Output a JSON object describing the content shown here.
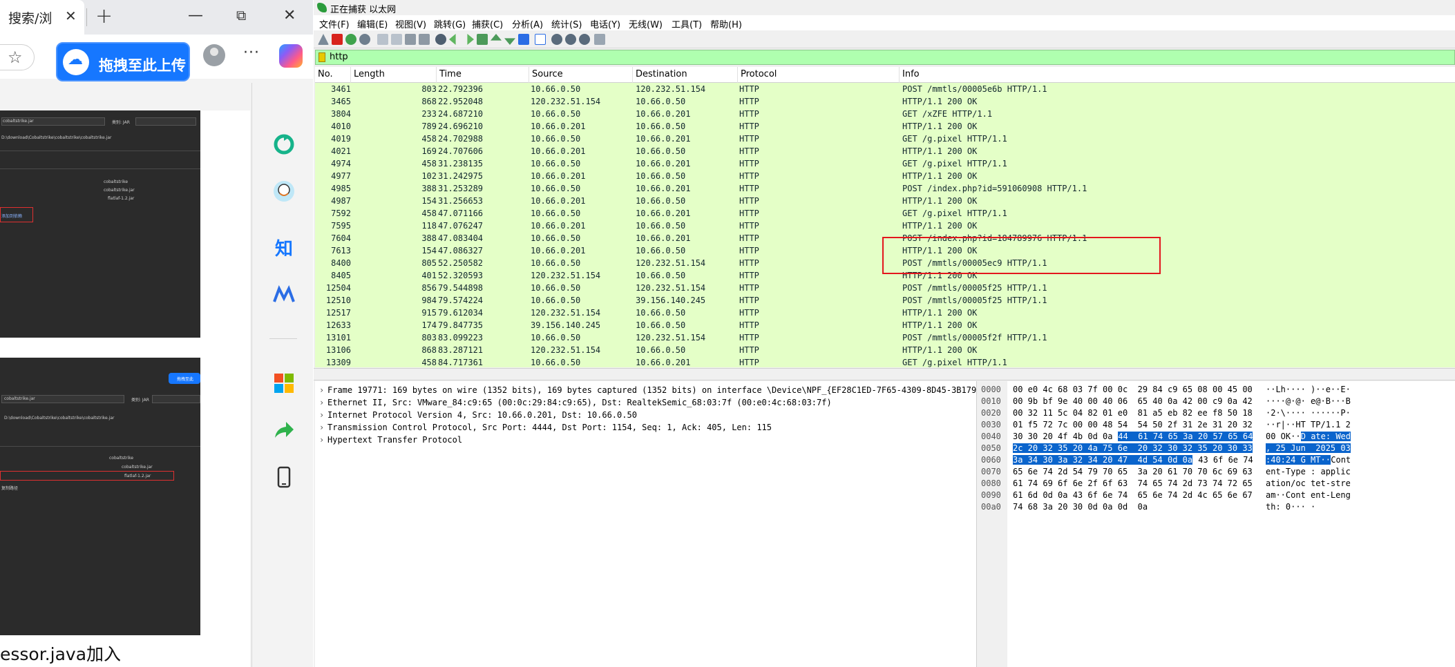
{
  "browser": {
    "tab_title": "搜索/浏",
    "tab_close": "✕",
    "new_tab": "+",
    "win_min": "—",
    "win_max": "⧉",
    "win_close": "✕",
    "upload_label": "拖拽至此上传",
    "more": "···",
    "caption": "essor.java加入",
    "shot1": {
      "label_a": "cobaltstrike.jar",
      "label_b": "类别: JAR",
      "path": "D:\\download\\Cobaltstrike\\cobaltstrike\\cobaltstrike.jar",
      "tree_a": "cobaltstrike",
      "tree_b": "cobaltstrike.jar",
      "tree_c": "flatlaf-1.2.jar",
      "highlight": "添加到依赖"
    },
    "shot2": {
      "upload_badge": "拖拽至此",
      "label_a": "cobaltstrike.jar",
      "label_b": "类别: JAR",
      "path": "D:\\download\\Cobaltstrike\\cobaltstrike\\cobaltstrike.jar",
      "tree_a": "cobaltstrike",
      "tree_b": "cobaltstrike.jar",
      "tree_c": "flatlaf-1.2.jar",
      "extra": "复制路径"
    }
  },
  "wireshark": {
    "title": "正在捕获 以太网",
    "menu": [
      "文件(F)",
      "编辑(E)",
      "视图(V)",
      "跳转(G)",
      "捕获(C)",
      "分析(A)",
      "统计(S)",
      "电话(Y)",
      "无线(W)",
      "工具(T)",
      "帮助(H)"
    ],
    "filter": "http",
    "columns": [
      "No.",
      "Length",
      "Time",
      "Source",
      "Destination",
      "Protocol",
      "Info"
    ],
    "packets": [
      {
        "no": "3461",
        "len": "803",
        "time": "22.792396",
        "src": "10.66.0.50",
        "dst": "120.232.51.154",
        "proto": "HTTP",
        "info": "POST /mmtls/00005e6b HTTP/1.1"
      },
      {
        "no": "3465",
        "len": "868",
        "time": "22.952048",
        "src": "120.232.51.154",
        "dst": "10.66.0.50",
        "proto": "HTTP",
        "info": "HTTP/1.1 200 OK"
      },
      {
        "no": "3804",
        "len": "233",
        "time": "24.687210",
        "src": "10.66.0.50",
        "dst": "10.66.0.201",
        "proto": "HTTP",
        "info": "GET /xZFE HTTP/1.1"
      },
      {
        "no": "4010",
        "len": "789",
        "time": "24.696210",
        "src": "10.66.0.201",
        "dst": "10.66.0.50",
        "proto": "HTTP",
        "info": "HTTP/1.1 200 OK"
      },
      {
        "no": "4019",
        "len": "458",
        "time": "24.702988",
        "src": "10.66.0.50",
        "dst": "10.66.0.201",
        "proto": "HTTP",
        "info": "GET /g.pixel HTTP/1.1"
      },
      {
        "no": "4021",
        "len": "169",
        "time": "24.707606",
        "src": "10.66.0.201",
        "dst": "10.66.0.50",
        "proto": "HTTP",
        "info": "HTTP/1.1 200 OK"
      },
      {
        "no": "4974",
        "len": "458",
        "time": "31.238135",
        "src": "10.66.0.50",
        "dst": "10.66.0.201",
        "proto": "HTTP",
        "info": "GET /g.pixel HTTP/1.1"
      },
      {
        "no": "4977",
        "len": "102",
        "time": "31.242975",
        "src": "10.66.0.201",
        "dst": "10.66.0.50",
        "proto": "HTTP",
        "info": "HTTP/1.1 200 OK"
      },
      {
        "no": "4985",
        "len": "388",
        "time": "31.253289",
        "src": "10.66.0.50",
        "dst": "10.66.0.201",
        "proto": "HTTP",
        "info": "POST /index.php?id=591060908 HTTP/1.1"
      },
      {
        "no": "4987",
        "len": "154",
        "time": "31.256653",
        "src": "10.66.0.201",
        "dst": "10.66.0.50",
        "proto": "HTTP",
        "info": "HTTP/1.1 200 OK"
      },
      {
        "no": "7592",
        "len": "458",
        "time": "47.071166",
        "src": "10.66.0.50",
        "dst": "10.66.0.201",
        "proto": "HTTP",
        "info": "GET /g.pixel HTTP/1.1"
      },
      {
        "no": "7595",
        "len": "118",
        "time": "47.076247",
        "src": "10.66.0.201",
        "dst": "10.66.0.50",
        "proto": "HTTP",
        "info": "HTTP/1.1 200 OK"
      },
      {
        "no": "7604",
        "len": "388",
        "time": "47.083404",
        "src": "10.66.0.50",
        "dst": "10.66.0.201",
        "proto": "HTTP",
        "info": "POST /index.php?id=184789976 HTTP/1.1"
      },
      {
        "no": "7613",
        "len": "154",
        "time": "47.086327",
        "src": "10.66.0.201",
        "dst": "10.66.0.50",
        "proto": "HTTP",
        "info": "HTTP/1.1 200 OK"
      },
      {
        "no": "8400",
        "len": "805",
        "time": "52.250582",
        "src": "10.66.0.50",
        "dst": "120.232.51.154",
        "proto": "HTTP",
        "info": "POST /mmtls/00005ec9 HTTP/1.1"
      },
      {
        "no": "8405",
        "len": "401",
        "time": "52.320593",
        "src": "120.232.51.154",
        "dst": "10.66.0.50",
        "proto": "HTTP",
        "info": "HTTP/1.1 200 OK"
      },
      {
        "no": "12504",
        "len": "856",
        "time": "79.544898",
        "src": "10.66.0.50",
        "dst": "120.232.51.154",
        "proto": "HTTP",
        "info": "POST /mmtls/00005f25 HTTP/1.1"
      },
      {
        "no": "12510",
        "len": "984",
        "time": "79.574224",
        "src": "10.66.0.50",
        "dst": "39.156.140.245",
        "proto": "HTTP",
        "info": "POST /mmtls/00005f25 HTTP/1.1"
      },
      {
        "no": "12517",
        "len": "915",
        "time": "79.612034",
        "src": "120.232.51.154",
        "dst": "10.66.0.50",
        "proto": "HTTP",
        "info": "HTTP/1.1 200 OK"
      },
      {
        "no": "12633",
        "len": "174",
        "time": "79.847735",
        "src": "39.156.140.245",
        "dst": "10.66.0.50",
        "proto": "HTTP",
        "info": "HTTP/1.1 200 OK"
      },
      {
        "no": "13101",
        "len": "803",
        "time": "83.099223",
        "src": "10.66.0.50",
        "dst": "120.232.51.154",
        "proto": "HTTP",
        "info": "POST /mmtls/00005f2f HTTP/1.1"
      },
      {
        "no": "13106",
        "len": "868",
        "time": "83.287121",
        "src": "120.232.51.154",
        "dst": "10.66.0.50",
        "proto": "HTTP",
        "info": "HTTP/1.1 200 OK"
      },
      {
        "no": "13309",
        "len": "458",
        "time": "84.717361",
        "src": "10.66.0.50",
        "dst": "10.66.0.201",
        "proto": "HTTP",
        "info": "GET /g.pixel HTTP/1.1"
      }
    ],
    "details": [
      "Frame 19771: 169 bytes on wire (1352 bits), 169 bytes captured (1352 bits) on interface \\Device\\NPF_{EF28C1ED-7F65-4309-8D45-3B179",
      "Ethernet II, Src: VMware_84:c9:65 (00:0c:29:84:c9:65), Dst: RealtekSemic_68:03:7f (00:e0:4c:68:03:7f)",
      "Internet Protocol Version 4, Src: 10.66.0.201, Dst: 10.66.0.50",
      "Transmission Control Protocol, Src Port: 4444, Dst Port: 1154, Seq: 1, Ack: 405, Len: 115",
      "Hypertext Transfer Protocol"
    ],
    "bytes": [
      {
        "off": "0000",
        "hex_a": "00 e0 4c 68 03 7f 00 0c  29 84 c9 65 08 00 45 00",
        "sel_hex": "",
        "hex_b": "",
        "asc_a": "··Lh···· )··e··E·",
        "sel_asc": "",
        "asc_b": ""
      },
      {
        "off": "0010",
        "hex_a": "00 9b bf 9e 40 00 40 06  65 40 0a 42 00 c9 0a 42",
        "sel_hex": "",
        "hex_b": "",
        "asc_a": "····@·@· e@·B···B",
        "sel_asc": "",
        "asc_b": ""
      },
      {
        "off": "0020",
        "hex_a": "00 32 11 5c 04 82 01 e0  81 a5 eb 82 ee f8 50 18",
        "sel_hex": "",
        "hex_b": "",
        "asc_a": "·2·\\···· ······P·",
        "sel_asc": "",
        "asc_b": ""
      },
      {
        "off": "0030",
        "hex_a": "01 f5 72 7c 00 00 48 54  54 50 2f 31 2e 31 20 32",
        "sel_hex": "",
        "hex_b": "",
        "asc_a": "··r|··HT TP/1.1 2",
        "sel_asc": "",
        "asc_b": ""
      },
      {
        "off": "0040",
        "hex_a": "30 30 20 4f 4b 0d 0a ",
        "sel_hex": "44  61 74 65 3a 20 57 65 64",
        "hex_b": "",
        "asc_a": "00 OK··",
        "sel_asc": "D ate: Wed",
        "asc_b": ""
      },
      {
        "off": "0050",
        "hex_a": "",
        "sel_hex": "2c 20 32 35 20 4a 75 6e  20 32 30 32 35 20 30 33",
        "hex_b": "",
        "asc_a": "",
        "sel_asc": ", 25 Jun  2025 03",
        "asc_b": ""
      },
      {
        "off": "0060",
        "hex_a": "",
        "sel_hex": "3a 34 30 3a 32 34 20 47  4d 54 0d 0a",
        "hex_b": " 43 6f 6e 74",
        "asc_a": "",
        "sel_asc": ":40:24 G MT··",
        "asc_b": "Cont"
      },
      {
        "off": "0070",
        "hex_a": "65 6e 74 2d 54 79 70 65  3a 20 61 70 70 6c 69 63",
        "sel_hex": "",
        "hex_b": "",
        "asc_a": "ent-Type : applic",
        "sel_asc": "",
        "asc_b": ""
      },
      {
        "off": "0080",
        "hex_a": "61 74 69 6f 6e 2f 6f 63  74 65 74 2d 73 74 72 65",
        "sel_hex": "",
        "hex_b": "",
        "asc_a": "ation/oc tet-stre",
        "sel_asc": "",
        "asc_b": ""
      },
      {
        "off": "0090",
        "hex_a": "61 6d 0d 0a 43 6f 6e 74  65 6e 74 2d 4c 65 6e 67",
        "sel_hex": "",
        "hex_b": "",
        "asc_a": "am··Cont ent-Leng",
        "sel_asc": "",
        "asc_b": ""
      },
      {
        "off": "00a0",
        "hex_a": "74 68 3a 20 30 0d 0a 0d  0a",
        "sel_hex": "",
        "hex_b": "",
        "asc_a": "th: 0··· ·",
        "sel_asc": "",
        "asc_b": ""
      }
    ],
    "colors": {
      "row_bg": "#e4ffc7",
      "filter_bg": "#afffaf",
      "highlight": "#e3161c",
      "selection": "#0a64cc"
    }
  }
}
